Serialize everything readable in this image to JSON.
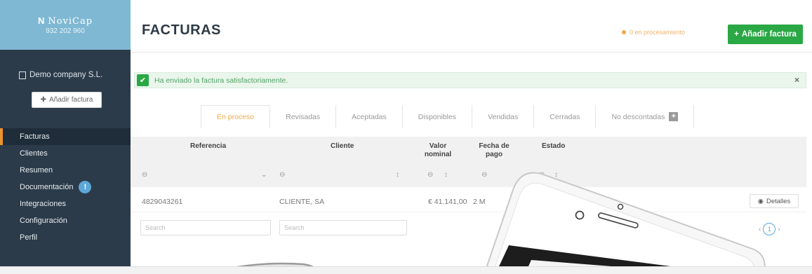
{
  "brand": {
    "name": "NoviCap",
    "logo_mark": "N",
    "phone": "932 202 960"
  },
  "sidebar": {
    "company": "Demo company S.L.",
    "add_button": "Añadir factura",
    "items": [
      {
        "label": "Facturas",
        "active": true
      },
      {
        "label": "Clientes"
      },
      {
        "label": "Resumen"
      },
      {
        "label": "Documentación",
        "badge": "!"
      },
      {
        "label": "Integraciones"
      },
      {
        "label": "Configuración"
      },
      {
        "label": "Perfil"
      }
    ]
  },
  "header": {
    "title": "FACTURAS",
    "pending_text": "0 en procesamiento",
    "add_button": "Añadir factura"
  },
  "alert": {
    "message": "Ha enviado la factura satisfactoriamente.",
    "close": "×"
  },
  "tabs": [
    {
      "label": "En proceso",
      "active": true
    },
    {
      "label": "Revisadas"
    },
    {
      "label": "Aceptadas"
    },
    {
      "label": "Disponibles"
    },
    {
      "label": "Vendidas"
    },
    {
      "label": "Cerradas"
    },
    {
      "label": "No descontadas",
      "plus": "+"
    }
  ],
  "table": {
    "columns": [
      "Referencia",
      "Cliente",
      "Valor nominal",
      "Fecha de pago",
      "Estado"
    ],
    "row": {
      "referencia": "4829043261",
      "cliente": "CLIENTE, SA",
      "valor": "€ 41.141,00",
      "fecha": "2 M",
      "details": "Detalles"
    },
    "search_placeholder": "Search",
    "page": "1"
  },
  "colors": {
    "accent": "#2aa845",
    "sidebar": "#2c3b4a",
    "brand": "#7fb8d3",
    "orange": "#f0922b"
  }
}
